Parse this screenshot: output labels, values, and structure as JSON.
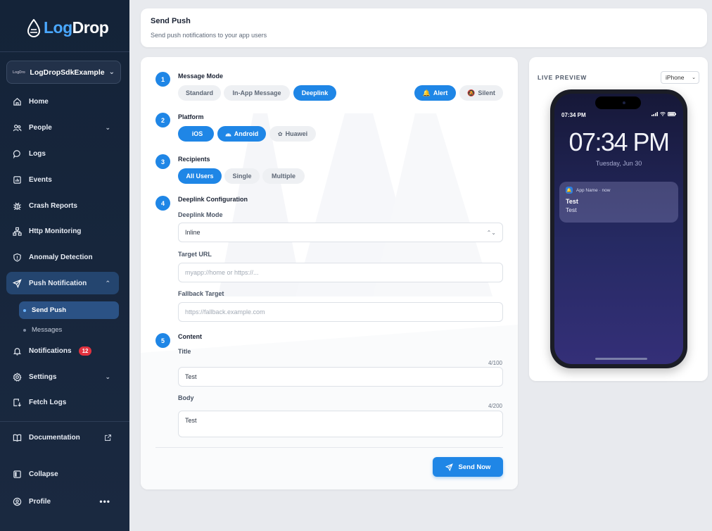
{
  "app": {
    "logo_part1": "Log",
    "logo_part2": "Drop"
  },
  "project": {
    "mini_logo": "LogDrop",
    "name": "LogDropSdkExample"
  },
  "sidebar": {
    "items": [
      {
        "label": "Home"
      },
      {
        "label": "People"
      },
      {
        "label": "Logs"
      },
      {
        "label": "Events"
      },
      {
        "label": "Crash Reports"
      },
      {
        "label": "Http Monitoring"
      },
      {
        "label": "Anomaly Detection"
      },
      {
        "label": "Push Notification"
      },
      {
        "label": "Notifications",
        "badge": "12"
      },
      {
        "label": "Settings"
      },
      {
        "label": "Fetch Logs"
      },
      {
        "label": "Documentation"
      },
      {
        "label": "Collapse"
      },
      {
        "label": "Profile"
      }
    ],
    "sub_items": [
      {
        "label": "Send Push"
      },
      {
        "label": "Messages"
      }
    ]
  },
  "header": {
    "title": "Send Push",
    "subtitle": "Send push notifications to your app users"
  },
  "form": {
    "steps": [
      "1",
      "2",
      "3",
      "4",
      "5"
    ],
    "message_mode": {
      "title": "Message Mode",
      "options": [
        "Standard",
        "In-App Message",
        "Deeplink"
      ],
      "selected": "Deeplink",
      "types": [
        "Alert",
        "Silent"
      ],
      "selected_type": "Alert"
    },
    "platform": {
      "title": "Platform",
      "options": [
        "iOS",
        "Android",
        "Huawei"
      ],
      "selected": [
        "iOS",
        "Android"
      ]
    },
    "recipients": {
      "title": "Recipients",
      "options": [
        "All Users",
        "Single",
        "Multiple"
      ],
      "selected": "All Users"
    },
    "deeplink": {
      "title": "Deeplink Configuration",
      "mode_label": "Deeplink Mode",
      "mode_value": "Inline",
      "target_label": "Target URL",
      "target_placeholder": "myapp://home or https://...",
      "fallback_label": "Fallback Target",
      "fallback_placeholder": "https://fallback.example.com"
    },
    "content": {
      "title": "Content",
      "title_label": "Title",
      "title_value": "Test",
      "title_counter": "4/100",
      "body_label": "Body",
      "body_value": "Test",
      "body_counter": "4/200"
    },
    "send_label": "Send Now"
  },
  "preview": {
    "title": "LIVE PREVIEW",
    "device": "iPhone",
    "status_time": "07:34 PM",
    "clock": "07:34 PM",
    "date": "Tuesday, Jun 30",
    "notification": {
      "app_line": "App Name · now",
      "title": "Test",
      "body": "Test"
    }
  },
  "colors": {
    "accent": "#1f86e6",
    "sidebar_bg": "#142338",
    "badge": "#e2323f"
  }
}
